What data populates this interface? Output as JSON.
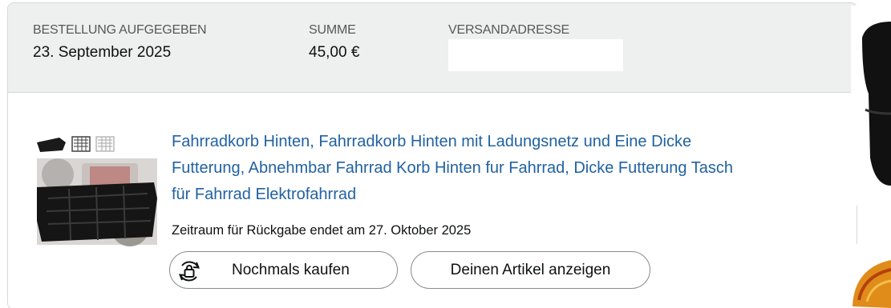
{
  "order_header": {
    "placed_label": "BESTELLUNG AUFGEGEBEN",
    "placed_value": "23. September 2025",
    "total_label": "SUMME",
    "total_value": "45,00 €",
    "ship_label": "VERSANDADRESSE"
  },
  "item": {
    "title_lines": [
      "Fahrradkorb Hinten, Fahrradkorb Hinten mit Ladungsnetz und Eine Dicke",
      "Futterung, Abnehmbar Fahrrad Korb Hinten fur Fahrrad, Dicke Futterung Tasch",
      "für Fahrrad Elektrofahrrad"
    ],
    "return_window": "Zeitraum für Rückgabe endet am 27. Oktober 2025"
  },
  "actions": {
    "buy_again_label": "Nochmals kaufen",
    "view_item_label": "Deinen Artikel anzeigen"
  },
  "icons": {
    "buy_again": "rebuy-icon"
  },
  "colors": {
    "link": "#2162a1",
    "header_bg": "#eeefef",
    "border": "#d5d9d9",
    "muted": "#565959"
  }
}
